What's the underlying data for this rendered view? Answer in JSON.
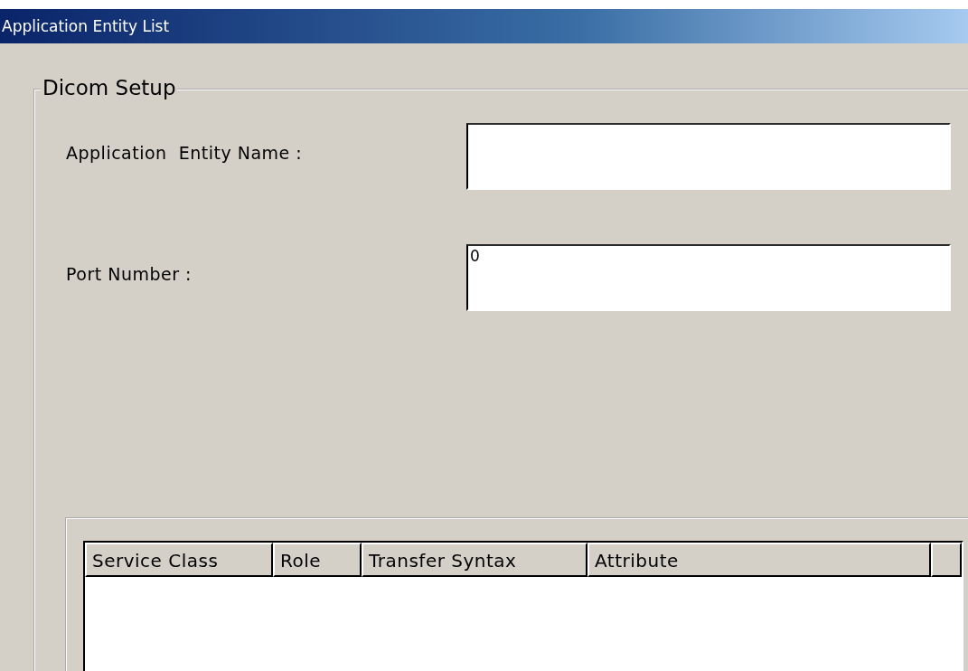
{
  "window": {
    "title": "Application Entity List"
  },
  "group": {
    "title": "Dicom Setup",
    "fields": [
      {
        "label": "Application  Entity Name :"
      },
      {
        "label": "Port Number :",
        "value": "0"
      }
    ]
  },
  "table": {
    "columns": [
      "Service Class",
      "Role",
      "Transfer Syntax",
      "Attribute"
    ]
  }
}
